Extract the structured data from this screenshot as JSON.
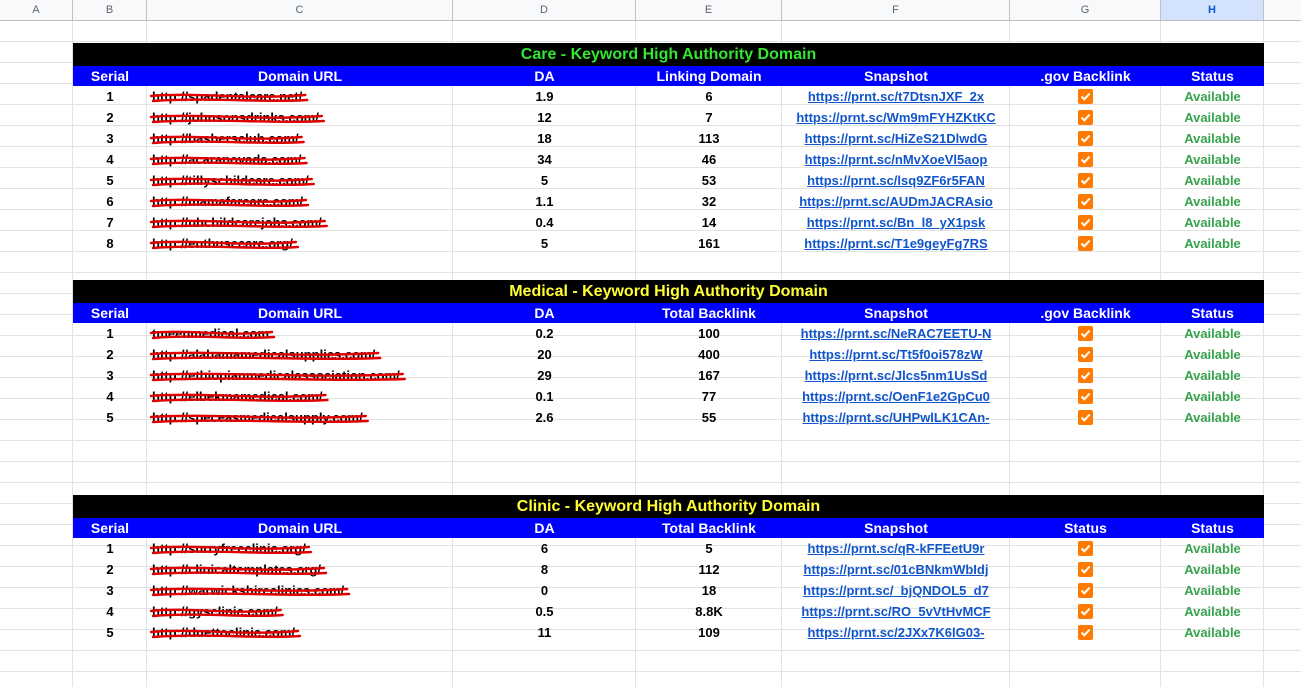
{
  "columns": [
    "A",
    "B",
    "C",
    "D",
    "E",
    "F",
    "G",
    "H"
  ],
  "sections": [
    {
      "title": "Care - Keyword High Authority Domain",
      "title_color": "#32e632",
      "headers": [
        "Serial",
        "Domain URL",
        "DA",
        "Linking Domain",
        "Snapshot",
        ".gov Backlink",
        "Status"
      ],
      "rows": [
        {
          "serial": "1",
          "url": "http://spadentalcare.net/",
          "da": "1.9",
          "val": "6",
          "snapshot": "https://prnt.sc/t7DtsnJXF_2x",
          "status": "Available"
        },
        {
          "serial": "2",
          "url": "http://johnsonsdrinks.com/",
          "da": "12",
          "val": "7",
          "snapshot": "https://prnt.sc/Wm9mFYHZKtKC",
          "status": "Available"
        },
        {
          "serial": "3",
          "url": "http://bashersclub.com/",
          "da": "18",
          "val": "113",
          "snapshot": "https://prnt.sc/HiZeS21DlwdG",
          "status": "Available"
        },
        {
          "serial": "4",
          "url": "http://acaranovada.com/",
          "da": "34",
          "val": "46",
          "snapshot": "https://prnt.sc/nMvXoeVl5aop",
          "status": "Available"
        },
        {
          "serial": "5",
          "url": "http://tillyschildcare.com/",
          "da": "5",
          "val": "53",
          "snapshot": "https://prnt.sc/lsq9ZF6r5FAN",
          "status": "Available"
        },
        {
          "serial": "6",
          "url": "http://mamafarcare.com/",
          "da": "1.1",
          "val": "32",
          "snapshot": "https://prnt.sc/AUDmJACRAsio",
          "status": "Available"
        },
        {
          "serial": "7",
          "url": "http://nhchildcarejobs.com/",
          "da": "0.4",
          "val": "14",
          "snapshot": "https://prnt.sc/Bn_l8_yX1psk",
          "status": "Available"
        },
        {
          "serial": "8",
          "url": "http://enthusecare.org/",
          "da": "5",
          "val": "161",
          "snapshot": "https://prnt.sc/T1e9geyFg7RS",
          "status": "Available"
        }
      ]
    },
    {
      "title": "Medical  - Keyword High Authority Domain",
      "title_color": "#ffff33",
      "headers": [
        "Serial",
        "Domain URL",
        "DA",
        "Total Backlink",
        "Snapshot",
        ".gov Backlink",
        "Status"
      ],
      "rows": [
        {
          "serial": "1",
          "url": "tmeenmedical.com",
          "da": "0.2",
          "val": "100",
          "snapshot": "https://prnt.sc/NeRAC7EETU-N",
          "status": "Available"
        },
        {
          "serial": "2",
          "url": "http://alabamamedicalsupplies.com/",
          "da": "20",
          "val": "400",
          "snapshot": "https://prnt.sc/Tt5f0oi578zW",
          "status": "Available"
        },
        {
          "serial": "3",
          "url": "http://ethiopianmedicalassociation.com/",
          "da": "29",
          "val": "167",
          "snapshot": "https://prnt.sc/Jlcs5nm1UsSd",
          "status": "Available"
        },
        {
          "serial": "4",
          "url": "http://elbekmamedical.com/",
          "da": "0.1",
          "val": "77",
          "snapshot": "https://prnt.sc/OenF1e2GpCu0",
          "status": "Available"
        },
        {
          "serial": "5",
          "url": "http://speceasmedicalsupply.com/",
          "da": "2.6",
          "val": "55",
          "snapshot": "https://prnt.sc/UHPwlLK1CAn-",
          "status": "Available"
        }
      ]
    },
    {
      "title": "Clinic  - Keyword High Authority Domain",
      "title_color": "#ffff33",
      "headers": [
        "Serial",
        "Domain URL",
        "DA",
        "Total Backlink",
        "Snapshot",
        "Status",
        "Status"
      ],
      "rows": [
        {
          "serial": "1",
          "url": "http://surryfreeclinic.org/",
          "da": "6",
          "val": "5",
          "snapshot": "https://prnt.sc/qR-kFFEetU9r",
          "status": "Available"
        },
        {
          "serial": "2",
          "url": "http://clinicaltemplates.org/",
          "da": "8",
          "val": "112",
          "snapshot": "https://prnt.sc/01cBNkmWbIdj",
          "status": "Available"
        },
        {
          "serial": "3",
          "url": "http://warwickshireclinics.com/",
          "da": "0",
          "val": "18",
          "snapshot": "https://prnt.sc/_bjQNDOL5_d7",
          "status": "Available"
        },
        {
          "serial": "4",
          "url": "http://gysclinic.com/",
          "da": "0.5",
          "val": "8.8K",
          "snapshot": "https://prnt.sc/RO_5vVtHvMCF",
          "status": "Available"
        },
        {
          "serial": "5",
          "url": "http://duettoclinic.com/",
          "da": "11",
          "val": "109",
          "snapshot": "https://prnt.sc/2JXx7K6lG03-",
          "status": "Available"
        }
      ]
    }
  ]
}
